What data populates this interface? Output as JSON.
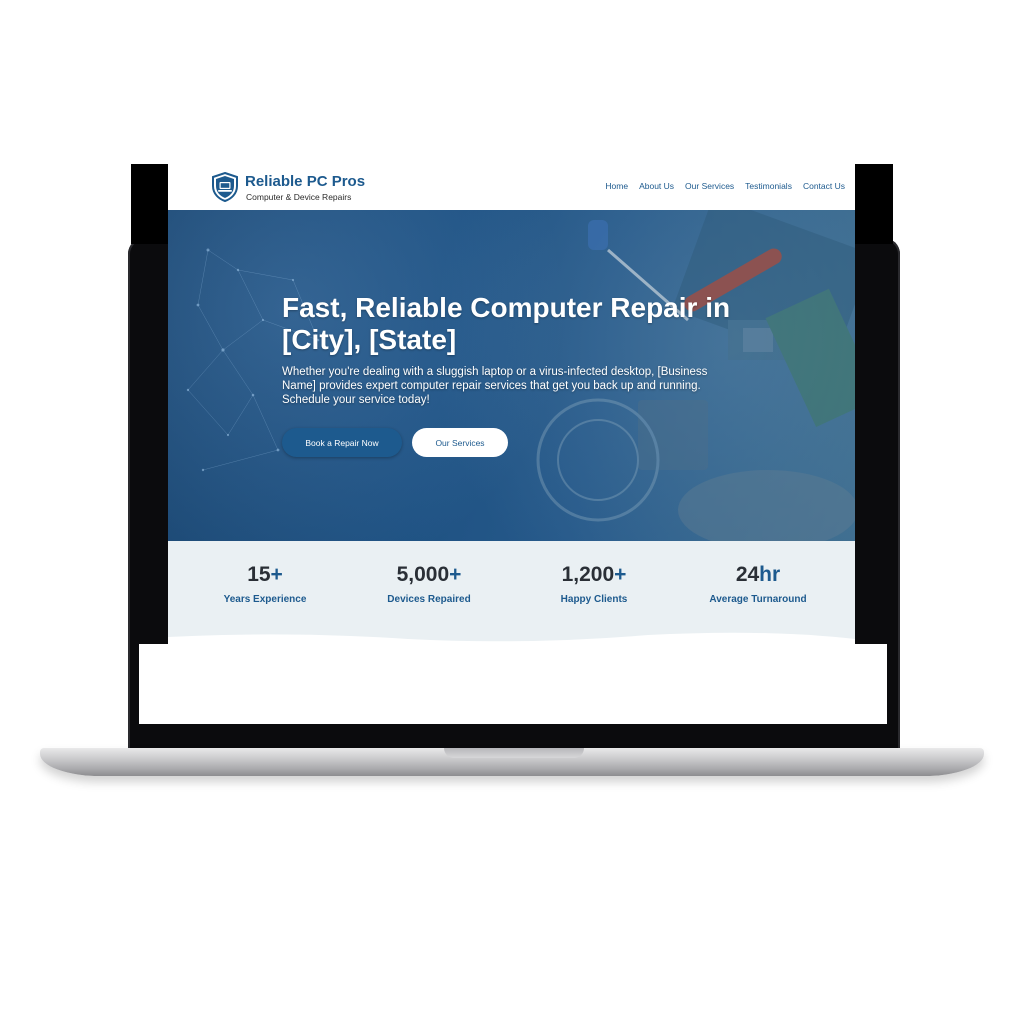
{
  "site": {
    "brand": {
      "name": "Reliable PC Pros",
      "tagline": "Computer & Device Repairs",
      "icon": "shield-laptop-icon",
      "accent": "#1d5a8e"
    },
    "nav": [
      {
        "label": "Home"
      },
      {
        "label": "About Us"
      },
      {
        "label": "Our Services"
      },
      {
        "label": "Testimonials"
      },
      {
        "label": "Contact Us"
      }
    ],
    "hero": {
      "title": "Fast, Reliable Computer Repair in [City], [State]",
      "description": "Whether you're dealing with a sluggish laptop or a virus-infected desktop, [Business Name] provides expert computer repair services that get you back up and running. Schedule your service today!",
      "primary_button": "Book a Repair Now",
      "secondary_button": "Our Services"
    },
    "stats": [
      {
        "number": "15",
        "suffix": "+",
        "label": "Years Experience"
      },
      {
        "number": "5,000",
        "suffix": "+",
        "label": "Devices Repaired"
      },
      {
        "number": "1,200",
        "suffix": "+",
        "label": "Happy Clients"
      },
      {
        "number": "24",
        "suffix": "hr",
        "label": "Average Turnaround"
      }
    ]
  }
}
